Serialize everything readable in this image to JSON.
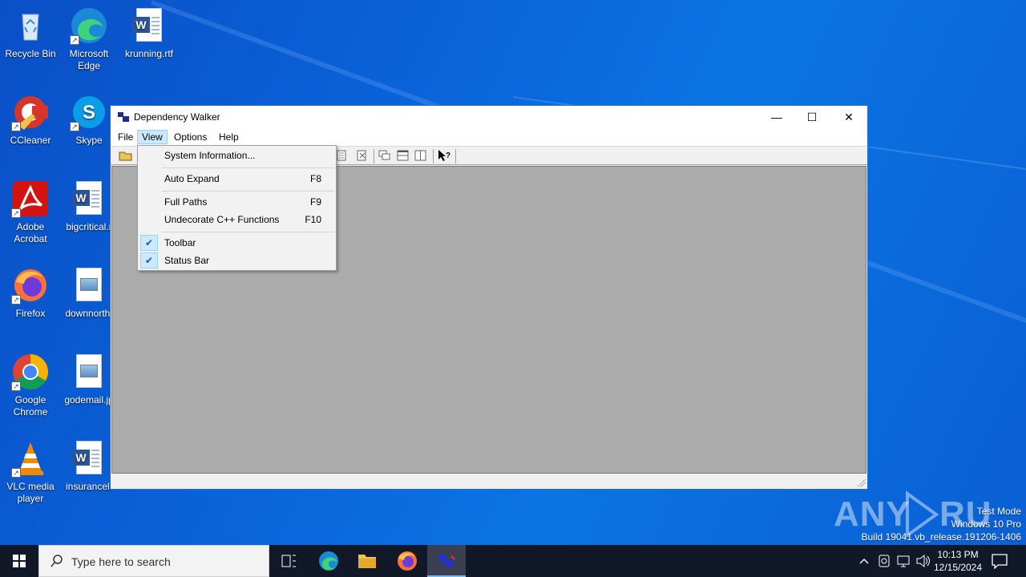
{
  "desktop": {
    "icons": [
      {
        "label": "Recycle Bin"
      },
      {
        "label": "Microsoft Edge"
      },
      {
        "label": "krunning.rtf"
      },
      {
        "label": "CCleaner"
      },
      {
        "label": "Skype"
      },
      {
        "label": "Adobe Acrobat"
      },
      {
        "label": "bigcritical.r"
      },
      {
        "label": "Firefox"
      },
      {
        "label": "downnorth."
      },
      {
        "label": "Google Chrome"
      },
      {
        "label": "godemail.jp"
      },
      {
        "label": "VLC media player"
      },
      {
        "label": "insurancel."
      }
    ]
  },
  "window": {
    "title": "Dependency Walker",
    "controls": {
      "minimize": "—",
      "maximize": "☐",
      "close": "✕"
    },
    "menu": [
      "File",
      "View",
      "Options",
      "Help"
    ]
  },
  "view_menu": {
    "items": [
      {
        "label": "System Information...",
        "shortcut": "",
        "checked": false
      },
      {
        "label": "Auto Expand",
        "shortcut": "F8",
        "checked": false
      },
      {
        "label": "Full Paths",
        "shortcut": "F9",
        "checked": false
      },
      {
        "label": "Undecorate C++ Functions",
        "shortcut": "F10",
        "checked": false
      },
      {
        "label": "Toolbar",
        "shortcut": "",
        "checked": true
      },
      {
        "label": "Status Bar",
        "shortcut": "",
        "checked": true
      }
    ]
  },
  "watermark": {
    "brand": "ANY RUN",
    "line1": "Test Mode",
    "line2": "Windows 10 Pro",
    "line3": "Build 19041.vb_release.191206-1406"
  },
  "taskbar": {
    "search_placeholder": "Type here to search",
    "time": "10:13 PM",
    "date": "12/15/2024"
  }
}
